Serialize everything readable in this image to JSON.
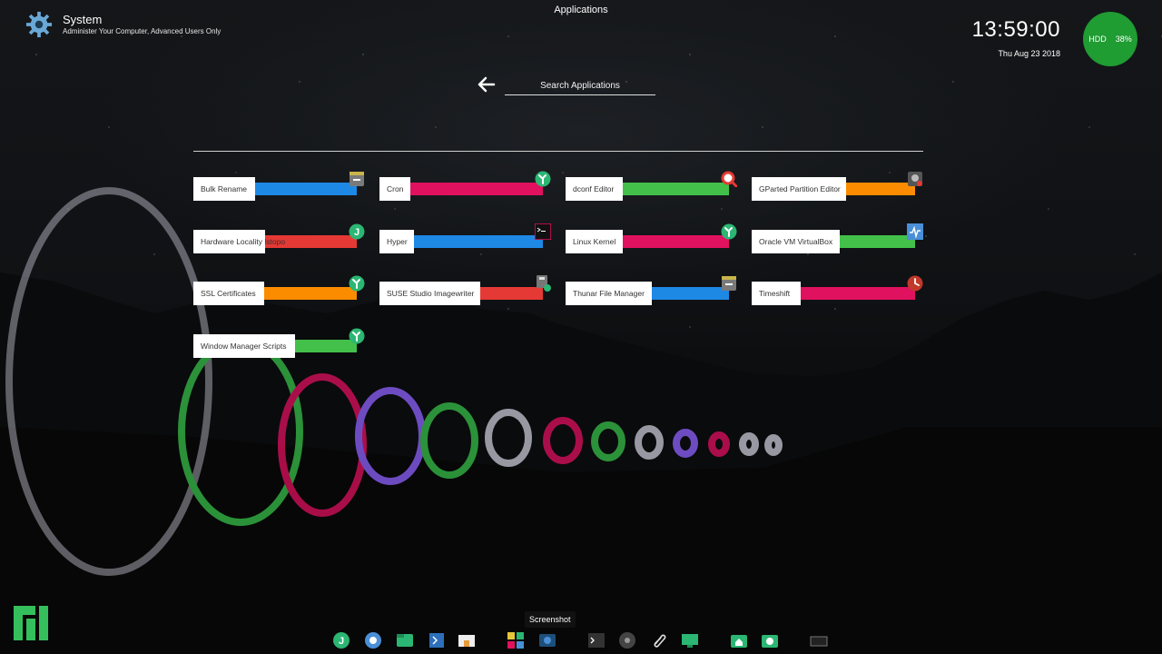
{
  "header": {
    "title": "System",
    "subtitle": "Administer Your Computer, Advanced Users Only",
    "center_title": "Applications"
  },
  "clock": {
    "time": "13:59:00",
    "date": "Thu Aug 23 2018"
  },
  "hdd": {
    "label": "HDD",
    "percent": "38%",
    "color": "#1f9c32"
  },
  "search": {
    "placeholder": "Search Applications"
  },
  "apps": [
    {
      "label": "Bulk Rename",
      "bar_color": "#1e88e5",
      "icon": "file-manager-icon"
    },
    {
      "label": "Cron",
      "bar_color": "#e0115f",
      "icon": "settings-wrench-icon"
    },
    {
      "label": "dconf Editor",
      "bar_color": "#43c04a",
      "icon": "magnifier-icon"
    },
    {
      "label": "GParted Partition Editor",
      "bar_color": "#fb8c00",
      "icon": "disk-icon"
    },
    {
      "label": "Hardware Locality lstopo",
      "bar_color": "#e53935",
      "icon": "j-circle-icon"
    },
    {
      "label": "Hyper",
      "bar_color": "#1e88e5",
      "icon": "terminal-icon"
    },
    {
      "label": "Linux Kernel",
      "bar_color": "#e0115f",
      "icon": "settings-wrench-icon"
    },
    {
      "label": "Oracle VM VirtualBox",
      "bar_color": "#43c04a",
      "icon": "virtualbox-icon"
    },
    {
      "label": "SSL Certificates",
      "bar_color": "#fb8c00",
      "icon": "settings-wrench-icon"
    },
    {
      "label": "SUSE Studio Imagewriter",
      "bar_color": "#e53935",
      "icon": "usb-drive-icon"
    },
    {
      "label": "Thunar File Manager",
      "bar_color": "#1e88e5",
      "icon": "file-manager-icon"
    },
    {
      "label": "Timeshift",
      "bar_color": "#e0115f",
      "icon": "timeshift-icon"
    },
    {
      "label": "Window Manager Scripts",
      "bar_color": "#43c04a",
      "icon": "settings-wrench-icon"
    }
  ],
  "dock": {
    "tooltip": "Screenshot",
    "items": [
      "j-app-icon",
      "chromium-icon",
      "files-icon",
      "vscode-icon",
      "archive-icon",
      "colors-icon",
      "screenshot-icon",
      "terminal-icon",
      "disk-icon",
      "paperclip-icon",
      "monitor-icon",
      "home-folder-icon",
      "timeshift-folder-icon",
      "workspace-icon"
    ]
  }
}
